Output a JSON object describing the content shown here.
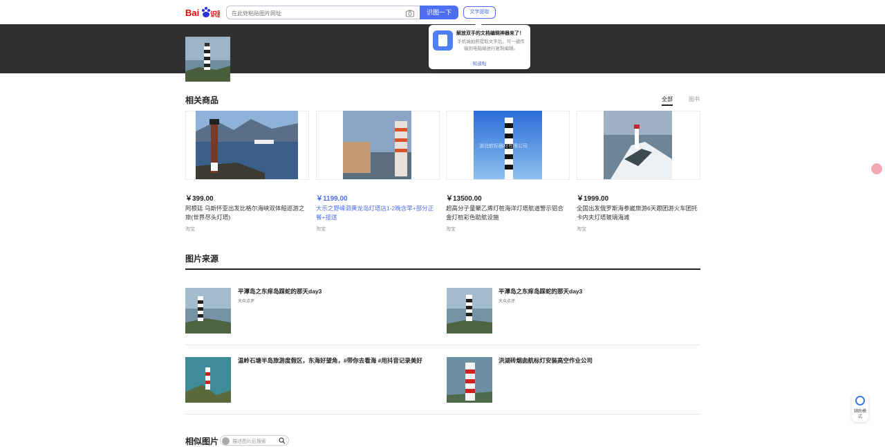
{
  "header": {
    "logo_text": "Bai 识图",
    "search_placeholder": "在此处粘贴图片网址",
    "search_button": "识图一下",
    "ocr_button": "文字提取"
  },
  "popup": {
    "title": "解放双手的文档编辑神器来了！",
    "desc": "手机端拍照提取文字后，可一键传输到电脑端进行复制编辑。",
    "link": "知道啦"
  },
  "related": {
    "title": "相关商品",
    "tabs": [
      "全部",
      "图书"
    ],
    "items": [
      {
        "price": "￥399.00",
        "title": "阿根廷 乌斯怀亚出发比格尔海峡双体船巡游之旅(世界尽头灯塔)",
        "shop": "淘宝"
      },
      {
        "price": "￥1199.00",
        "title": "大乐之野嵊泗黄龙岛灯塔店1-2晚含早+部分正餐+接送",
        "shop": "淘宝"
      },
      {
        "price": "￥13500.00",
        "title": "超高分子量聚乙烯灯桩海洋灯塔航道警示铝合金灯桩彩色助航设施",
        "shop": "淘宝",
        "watermark": "湖北航标器材有限公司"
      },
      {
        "price": "￥1999.00",
        "title": "全国出发俄罗斯海参崴旅游6天跟团游火车团托卡内夫灯塔玻璃海滩",
        "shop": "淘宝"
      }
    ]
  },
  "source": {
    "title": "图片来源",
    "items": [
      {
        "title": "平潭岛之东痒岛踩蛇的那天day3",
        "sub": "大众点评"
      },
      {
        "title": "平潭岛之东痒岛踩蛇的那天day3",
        "sub": "大众点评"
      },
      {
        "title": "温岭石塘半岛旅游度假区，东海好望角，#带你去看海 #用抖音记录美好",
        "sub": ""
      },
      {
        "title": "洪湖砖烟囱航标灯安装高空作业公司",
        "sub": ""
      }
    ]
  },
  "similar": {
    "title": "相似图片",
    "search_placeholder": "描述图片后搜索"
  },
  "assist": {
    "label": "辅助模式"
  },
  "colors": {
    "accent": "#4e6ef2",
    "banner": "#303030"
  }
}
